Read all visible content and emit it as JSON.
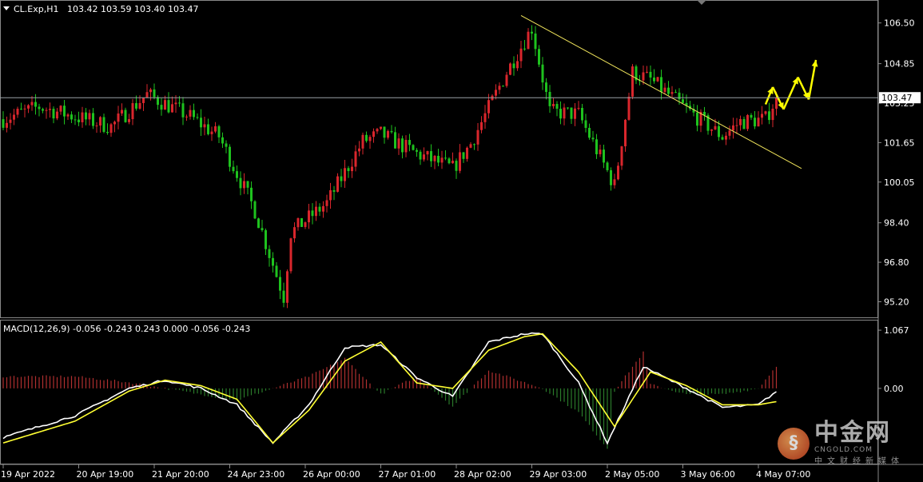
{
  "header": {
    "symbol_label": "CL.Exp,H1",
    "ohlc_text": "103.42 103.59 103.40 103.47"
  },
  "price_axis": {
    "ticks": [
      "106.50",
      "104.85",
      "103.25",
      "101.65",
      "100.05",
      "98.40",
      "96.80",
      "95.20"
    ],
    "tick_values": [
      106.5,
      104.85,
      103.25,
      101.65,
      100.05,
      98.4,
      96.8,
      95.2
    ],
    "current_price_label": "103.47",
    "current_price": 103.47
  },
  "macd_panel": {
    "label": "MACD(12,26,9) -0.056 -0.243 0.243 0.000 -0.056 -0.243",
    "ticks": [
      "1.067",
      "0.00"
    ],
    "tick_values": [
      1.067,
      0.0
    ]
  },
  "time_axis": {
    "labels": [
      "19 Apr 2022",
      "20 Apr 19:00",
      "21 Apr 20:00",
      "24 Apr 23:00",
      "26 Apr 00:00",
      "27 Apr 01:00",
      "28 Apr 02:00",
      "29 Apr 03:00",
      "2 May 05:00",
      "3 May 06:00",
      "4 May 07:00"
    ],
    "label_bar_index": [
      0,
      21,
      42,
      63,
      84,
      105,
      126,
      147,
      168,
      189,
      210
    ]
  },
  "watermark": {
    "logo_glyph": "§",
    "cn_text": "中金网",
    "en_text": "CNGOLD.COM",
    "cn_small": "中文财经新媒体"
  },
  "colors": {
    "bull": "#d9262c",
    "bear": "#1ec21e",
    "macd_line": "#ffffff",
    "signal_line": "#ffff33",
    "trendline": "#f2e65c",
    "projection": "#ffff00",
    "hist_pos": "#b03030",
    "hist_neg": "#2a7a2a"
  },
  "chart_data": {
    "type": "line",
    "title": "CL.Exp,H1",
    "ylim": [
      94.6,
      107.3
    ],
    "x_labels_note": "hourly bars, ~222 visible",
    "series": [
      {
        "name": "CL.Exp",
        "x": [
          0,
          10,
          20,
          30,
          40,
          52,
          60,
          70,
          78,
          80,
          90,
          100,
          105,
          115,
          125,
          130,
          140,
          147,
          152,
          160,
          170,
          175,
          180,
          185,
          190,
          200,
          205,
          212,
          215
        ],
        "values": [
          102.6,
          103.1,
          102.7,
          102.3,
          103.6,
          102.7,
          101.9,
          98.9,
          95.4,
          98.0,
          99.2,
          101.7,
          102.0,
          101.2,
          100.6,
          101.6,
          104.5,
          106.3,
          102.9,
          102.8,
          99.9,
          104.5,
          104.2,
          103.6,
          103.0,
          101.9,
          102.5,
          102.6,
          103.47
        ]
      },
      {
        "name": "MACD(12,26,9)",
        "x": [
          0,
          20,
          35,
          45,
          55,
          65,
          75,
          85,
          95,
          105,
          115,
          125,
          135,
          145,
          150,
          160,
          168,
          178,
          190,
          200,
          210,
          215
        ],
        "values": [
          -0.9,
          -0.5,
          0.0,
          0.15,
          0.0,
          -0.3,
          -1.0,
          -0.3,
          0.75,
          0.8,
          0.2,
          -0.15,
          0.85,
          1.0,
          1.0,
          0.1,
          -1.0,
          0.4,
          0.0,
          -0.35,
          -0.3,
          -0.056
        ]
      },
      {
        "name": "Signal",
        "x": [
          0,
          20,
          35,
          45,
          55,
          65,
          75,
          85,
          95,
          105,
          115,
          125,
          135,
          145,
          150,
          160,
          170,
          180,
          190,
          200,
          210,
          215
        ],
        "values": [
          -1.0,
          -0.6,
          -0.05,
          0.15,
          0.05,
          -0.2,
          -1.0,
          -0.4,
          0.5,
          0.85,
          0.1,
          0.0,
          0.7,
          0.95,
          1.0,
          0.3,
          -0.7,
          0.3,
          0.05,
          -0.3,
          -0.3,
          -0.243
        ]
      }
    ],
    "annotations": {
      "trendline": {
        "from": [
          144,
          106.8
        ],
        "to": [
          222,
          100.6
        ]
      },
      "projection_path": [
        [
          212,
          103.2
        ],
        [
          214,
          103.9
        ],
        [
          217,
          103.0
        ],
        [
          221,
          104.3
        ],
        [
          224,
          103.4
        ],
        [
          226,
          105.0
        ]
      ]
    }
  }
}
